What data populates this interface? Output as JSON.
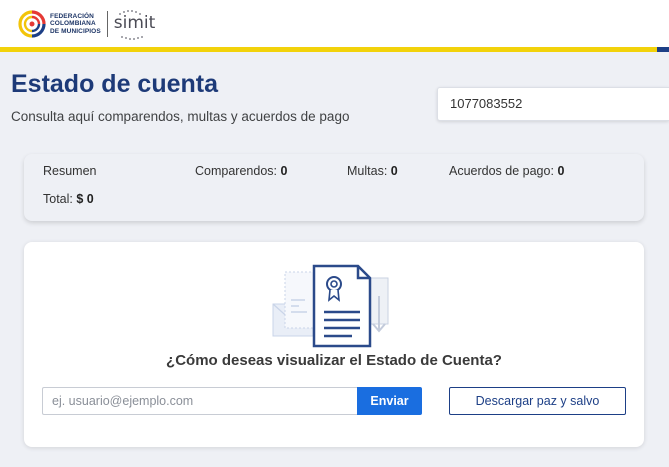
{
  "header": {
    "logo_fcm_lines": [
      "FEDERACIÓN",
      "COLOMBIANA",
      "DE MUNICIPIOS"
    ],
    "logo_simit": "simit",
    "stripe_color": "#f2d20a",
    "brand_color": "#1d3f86"
  },
  "page": {
    "title": "Estado de cuenta",
    "subtitle": "Consulta aquí comparendos, multas y acuerdos de pago",
    "document_number": "1077083552"
  },
  "summary": {
    "resumen_label": "Resumen",
    "comparendos_label": "Comparendos:",
    "comparendos_value": "0",
    "multas_label": "Multas:",
    "multas_value": "0",
    "acuerdos_label": "Acuerdos de pago:",
    "acuerdos_value": "0",
    "total_label": "Total:",
    "total_value": "$ 0"
  },
  "main": {
    "illustration_icon": "document-certificate-icon",
    "question": "¿Cómo deseas visualizar el Estado de Cuenta?",
    "email_placeholder": "ej. usuario@ejemplo.com",
    "send_label": "Enviar",
    "download_label": "Descargar paz y salvo",
    "accent_color": "#1a6ee0"
  }
}
